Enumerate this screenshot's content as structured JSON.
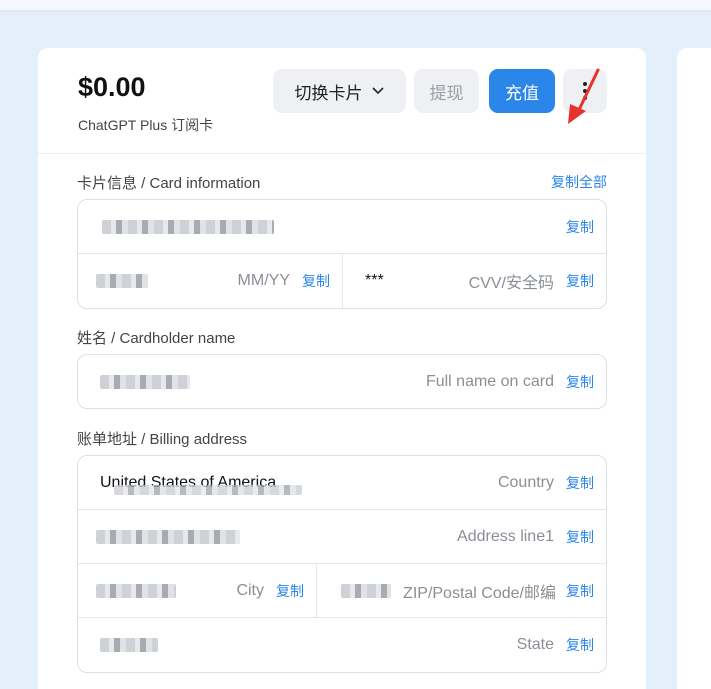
{
  "header": {
    "balance": "$0.00",
    "card_name": "ChatGPT Plus 订阅卡",
    "switch_card_label": "切换卡片",
    "withdraw_label": "提现",
    "topup_label": "充值"
  },
  "card_info": {
    "section_label": "卡片信息 / Card information",
    "copy_all_label": "复制全部",
    "expiry_placeholder": "MM/YY",
    "cvv_value": "***",
    "cvv_placeholder": "CVV/安全码"
  },
  "cardholder": {
    "section_label": "姓名 / Cardholder name",
    "name_placeholder": "Full name on card"
  },
  "billing": {
    "section_label": "账单地址 / Billing address",
    "country_value": "United States of America",
    "country_placeholder": "Country",
    "address_placeholder": "Address line1",
    "city_placeholder": "City",
    "zip_placeholder": "ZIP/Postal Code/邮编",
    "state_placeholder": "State"
  },
  "copy_label": "复制",
  "colors": {
    "accent": "#2b86ea",
    "arrow": "#e8322d",
    "background": "#e3f0fb"
  }
}
